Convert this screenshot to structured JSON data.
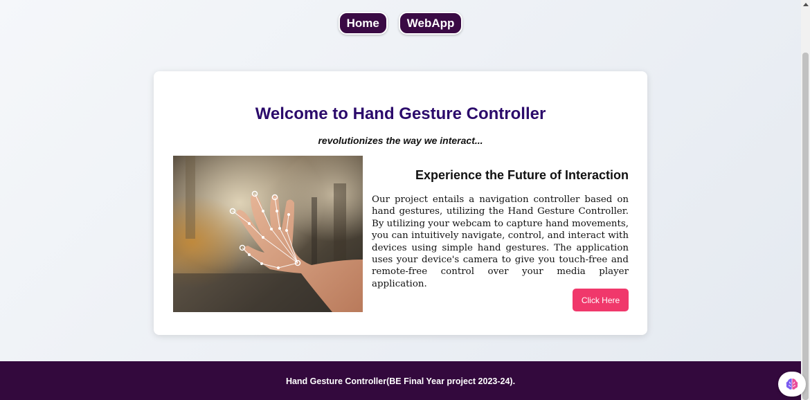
{
  "nav": {
    "home_label": "Home",
    "webapp_label": "WebApp"
  },
  "card": {
    "title": "Welcome to Hand Gesture Controller",
    "subtitle": "revolutionizes the way we interact...",
    "section_heading": "Experience the Future of Interaction",
    "description": "Our project entails a navigation controller based on hand gestures, utilizing the Hand Gesture Controller. By utilizing your webcam to capture hand movements, you can intuitively navigate, control, and interact with devices using simple hand gestures. The application uses your device's camera to give you touch-free and remote-free control over your media player application.",
    "button_label": "Click Here",
    "image_icon": "hand-landmarks-icon"
  },
  "footer": {
    "text": "Hand Gesture Controller(BE Final Year project 2023-24)."
  },
  "widget": {
    "icon": "brain-icon"
  },
  "colors": {
    "nav_bg": "#3a0a44",
    "title": "#2b0a6b",
    "cta": "#f0386b",
    "footer_bg": "#33093d"
  }
}
